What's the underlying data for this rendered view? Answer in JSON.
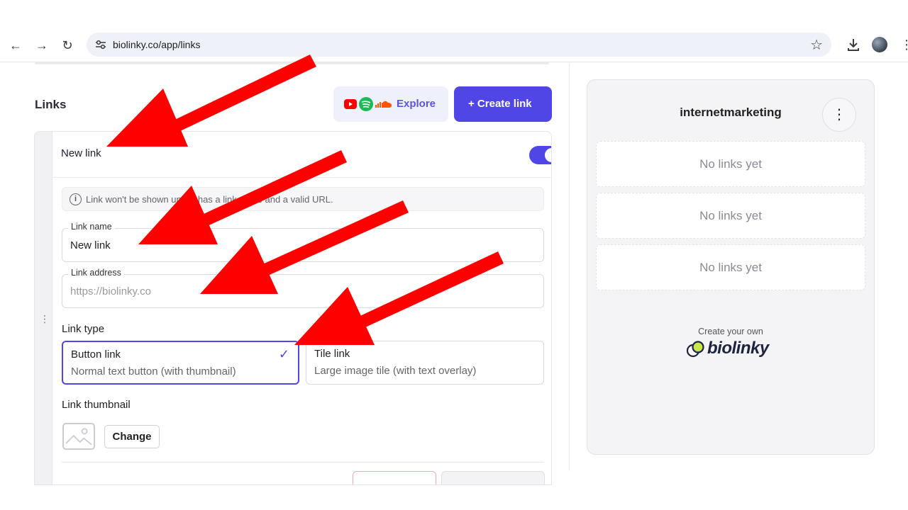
{
  "browser": {
    "url": "biolinky.co/app/links",
    "back_glyph": "←",
    "forward_glyph": "→",
    "reload_glyph": "↻",
    "bookmark_glyph": "☆",
    "menu_glyph": "⋮"
  },
  "header": {
    "title": "Links",
    "explore_label": "Explore",
    "create_label": "+ Create link"
  },
  "link_card": {
    "title": "New link",
    "enabled": true,
    "notice_icon": "i",
    "notice": "Link won't be shown until it has a link name and a valid URL.",
    "name_field": {
      "label": "Link name",
      "value": "New link"
    },
    "address_field": {
      "label": "Link address",
      "placeholder": "https://biolinky.co"
    },
    "link_type_label": "Link type",
    "types": [
      {
        "title": "Button link",
        "description": "Normal text button (with thumbnail)",
        "selected": true,
        "check": "✓"
      },
      {
        "title": "Tile link",
        "description": "Large image tile (with text overlay)",
        "selected": false
      }
    ],
    "thumbnail_label": "Link thumbnail",
    "change_label": "Change",
    "drag_handle": "⋮"
  },
  "preview": {
    "username": "internetmarketing",
    "menu_glyph": "⋮",
    "items": [
      "No links yet",
      "No links yet",
      "No links yet"
    ],
    "create_own": "Create your own",
    "brand": "biolinky"
  },
  "icons": {
    "explore": [
      "youtube-icon",
      "spotify-icon",
      "soundcloud-icon"
    ],
    "thumbnail": "image-placeholder-icon"
  },
  "colors": {
    "accent": "#4f46e5",
    "annotation_arrow": "#ff0000",
    "youtube": "#ff0000",
    "spotify": "#1db954",
    "soundcloud": "#ff5500"
  }
}
